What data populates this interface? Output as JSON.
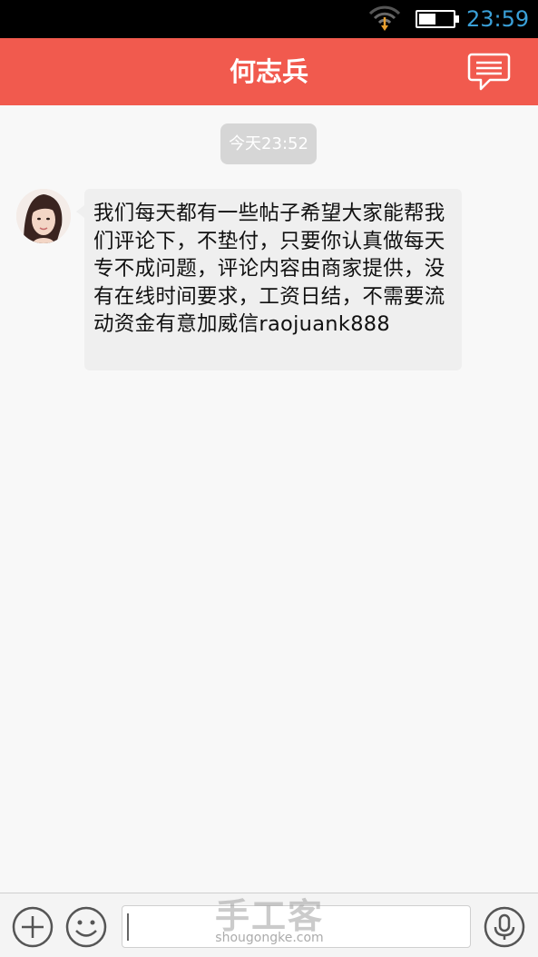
{
  "status_bar": {
    "time": "23:59",
    "battery_level": 0.5,
    "icons": [
      "wifi-icon",
      "battery-icon"
    ]
  },
  "header": {
    "title": "何志兵",
    "action_icon": "message-icon",
    "background": "#f15a4e"
  },
  "conversation": {
    "timestamp": "今天23:52",
    "messages": [
      {
        "sender_avatar": "avatar",
        "text": "我们每天都有一些帖子希望大家能帮我们评论下，不垫付，只要你认真做每天专不成问题，评论内容由商家提供，没有在线时间要求，工资日结，不需要流动资金有意加威信raojuank888"
      }
    ]
  },
  "input_bar": {
    "icons": [
      "plus-icon",
      "emoji-icon",
      "microphone-icon"
    ],
    "input_value": ""
  },
  "watermark": {
    "logo": "手工客",
    "url": "shougongke.com"
  }
}
